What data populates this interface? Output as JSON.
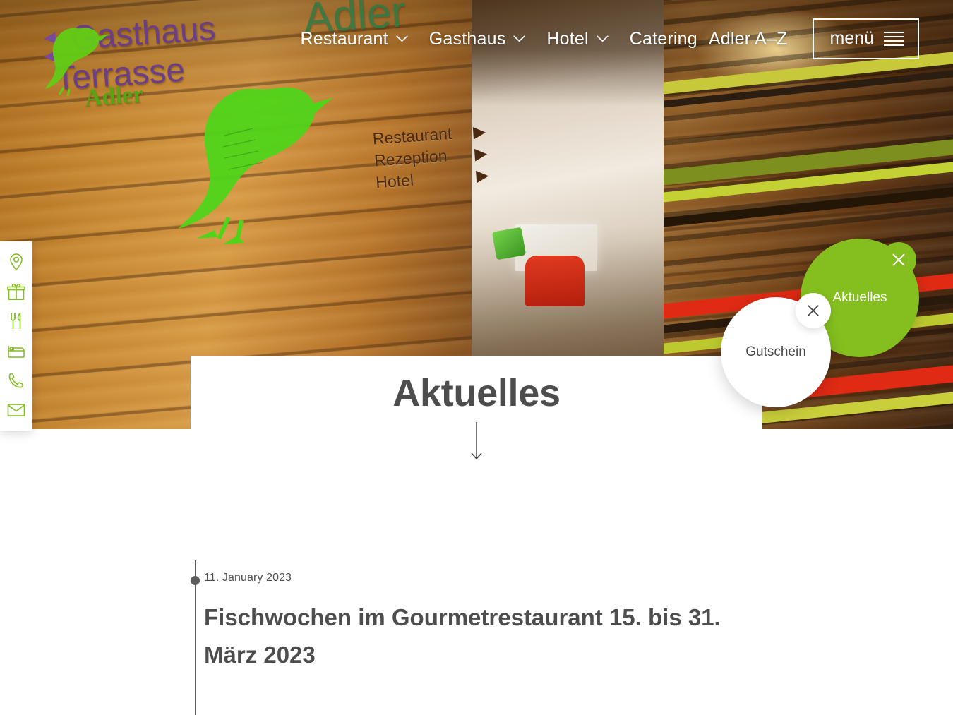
{
  "site": {
    "brand_sign": {
      "line1": "Gasthaus",
      "line2": "Terrasse",
      "line3": "Adler",
      "big_word": "Adler",
      "arrow_glyph": "◀",
      "column": [
        "Restaurant",
        "Rezeption",
        "Hotel"
      ],
      "column_arrow": "▶"
    },
    "accent_green": "#85bf1f",
    "underline_green": "#8dc021",
    "text_gray": "#4d4d4d"
  },
  "nav": {
    "items": [
      {
        "label": "Restaurant",
        "has_dropdown": true
      },
      {
        "label": "Gasthaus",
        "has_dropdown": true
      },
      {
        "label": "Hotel",
        "has_dropdown": true
      },
      {
        "label": "Catering",
        "has_dropdown": false
      },
      {
        "label": "Adler A–Z",
        "has_dropdown": false
      }
    ],
    "menu_button": {
      "label": "menü",
      "icon": "hamburger-icon"
    }
  },
  "rail": {
    "items": [
      {
        "icon": "location-pin-icon",
        "name": "anfahrt"
      },
      {
        "icon": "gift-icon",
        "name": "gutschein"
      },
      {
        "icon": "cutlery-icon",
        "name": "restaurant"
      },
      {
        "icon": "bed-icon",
        "name": "hotel"
      },
      {
        "icon": "phone-icon",
        "name": "telefon"
      },
      {
        "icon": "mail-icon",
        "name": "email"
      }
    ]
  },
  "bubbles": [
    {
      "label": "Aktuelles",
      "style": "green",
      "close_icon": "close-icon"
    },
    {
      "label": "Gutschein",
      "style": "white",
      "close_icon": "close-icon"
    }
  ],
  "main": {
    "page_title": "Aktuelles",
    "scroll_hint_icon": "arrow-down-icon"
  },
  "articles": [
    {
      "date": "11. January 2023",
      "title": "Fischwochen im Gourmetrestaurant 15. bis 31. März 2023"
    }
  ]
}
